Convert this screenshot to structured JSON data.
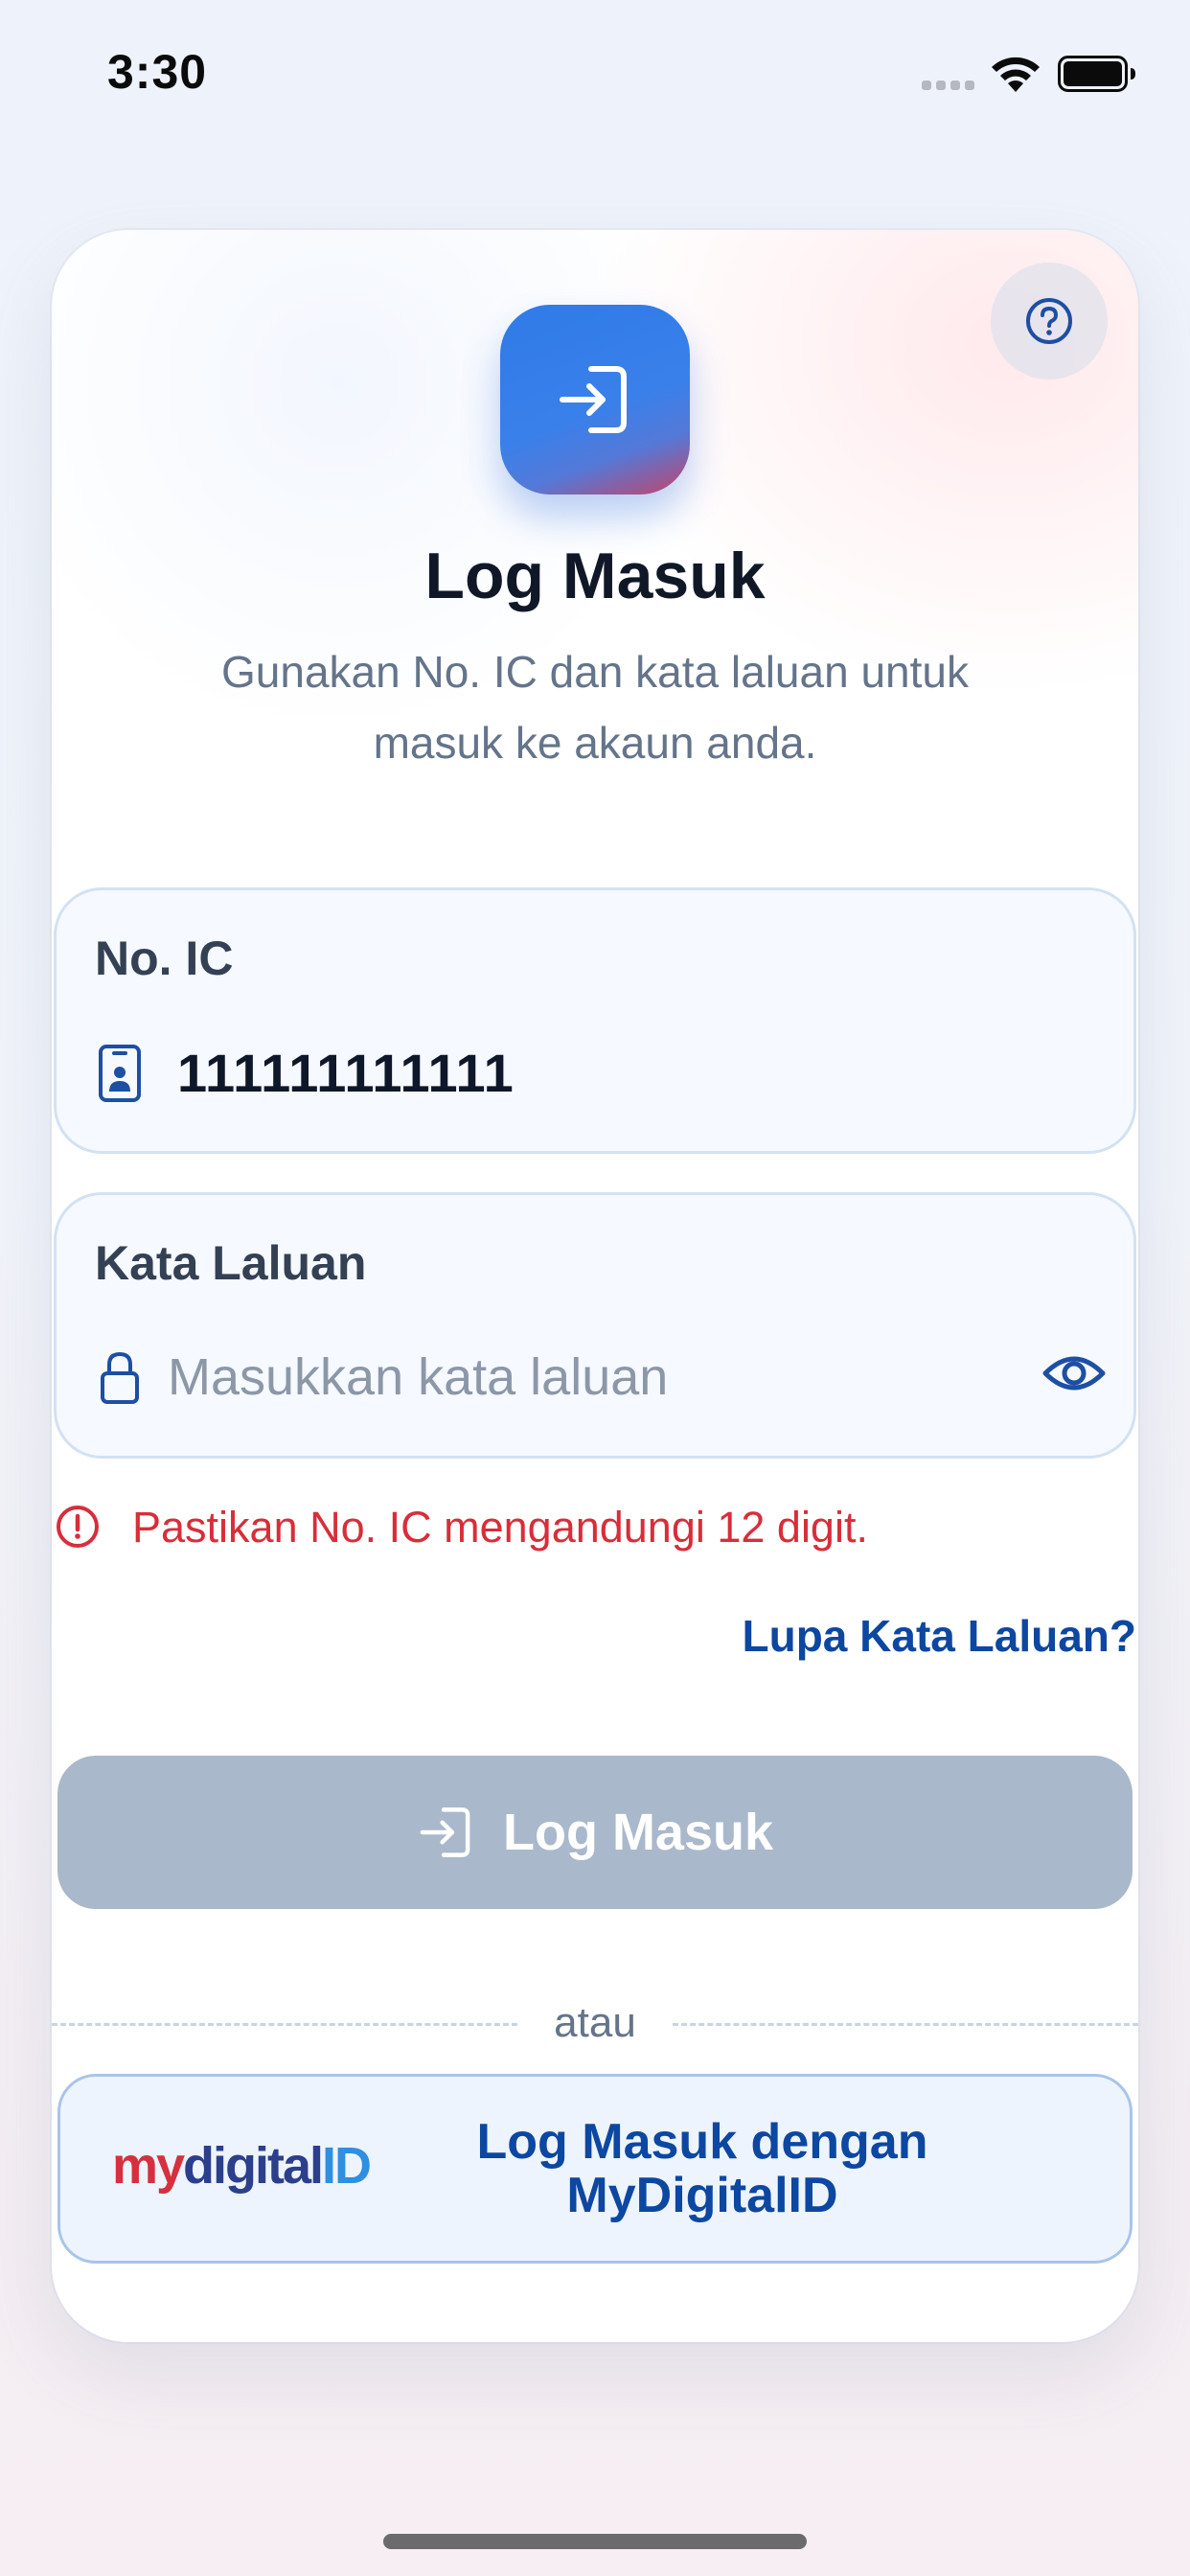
{
  "status_bar": {
    "time": "3:30"
  },
  "header": {
    "title": "Log Masuk",
    "subtitle": "Gunakan No. IC dan kata laluan untuk masuk ke akaun anda."
  },
  "form": {
    "ic": {
      "label": "No. IC",
      "value": "111111111111"
    },
    "password": {
      "label": "Kata Laluan",
      "placeholder": "Masukkan kata laluan",
      "value": ""
    },
    "error": "Pastikan No. IC mengandungi 12 digit.",
    "forgot": "Lupa Kata Laluan?",
    "submit": "Log Masuk"
  },
  "divider": "atau",
  "mydigital": {
    "logo_my": "my",
    "logo_digital": "digital",
    "logo_id": "ID",
    "label": "Log Masuk dengan MyDigitalID"
  },
  "colors": {
    "primary": "#0c47a1",
    "accent": "#2f7be8",
    "error": "#d92d3a",
    "disabled_button": "#aab8cb"
  },
  "icons": [
    "help-icon",
    "login-icon",
    "id-card-icon",
    "lock-icon",
    "eye-icon",
    "error-icon"
  ]
}
